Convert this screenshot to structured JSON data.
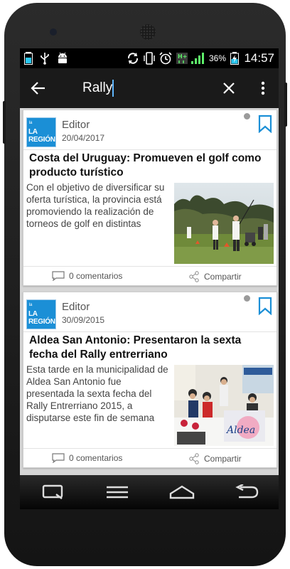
{
  "status_bar": {
    "battery_percent": "36%",
    "time": "14:57",
    "icons": [
      "battery-icon",
      "usb-icon",
      "android-debug-icon",
      "sync-icon",
      "vibrate-icon",
      "alarm-icon",
      "h-plus-icon",
      "signal-icon",
      "charging-battery-icon"
    ]
  },
  "toolbar": {
    "search_value": "Rally",
    "back_icon": "arrow-left-icon",
    "clear_icon": "close-icon",
    "menu_icon": "overflow-menu-icon"
  },
  "articles": [
    {
      "source_logo": "LA REGIÓN",
      "source_logo_small": "la",
      "author": "Editor",
      "date": "20/04/2017",
      "title": "Costa del Uruguay: Promueven el golf como producto turístico",
      "excerpt": "Con el objetivo de diversificar su oferta turística, la provincia está promoviendo la realización de torneos de golf en distintas",
      "comments_label": "0 comentarios",
      "share_label": "Compartir"
    },
    {
      "source_logo": "LA REGIÓN",
      "source_logo_small": "la",
      "author": "Editor",
      "date": "30/09/2015",
      "title": "Aldea San Antonio: Presentaron la sexta fecha del Rally entrerriano",
      "excerpt": "Esta tarde en la municipalidad de Aldea San Antonio fue presentada la sexta fecha del Rally Entrerriano 2015, a disputarse este fin de semana",
      "comments_label": "0 comentarios",
      "share_label": "Compartir",
      "image_caption": "Aldea"
    }
  ],
  "colors": {
    "accent": "#1b8fd6",
    "toolbar_bg": "#1a1a1a",
    "status_bar_bg": "#000000"
  },
  "nav_bar": [
    "recent-apps-icon",
    "menu-icon",
    "home-icon",
    "back-icon"
  ]
}
